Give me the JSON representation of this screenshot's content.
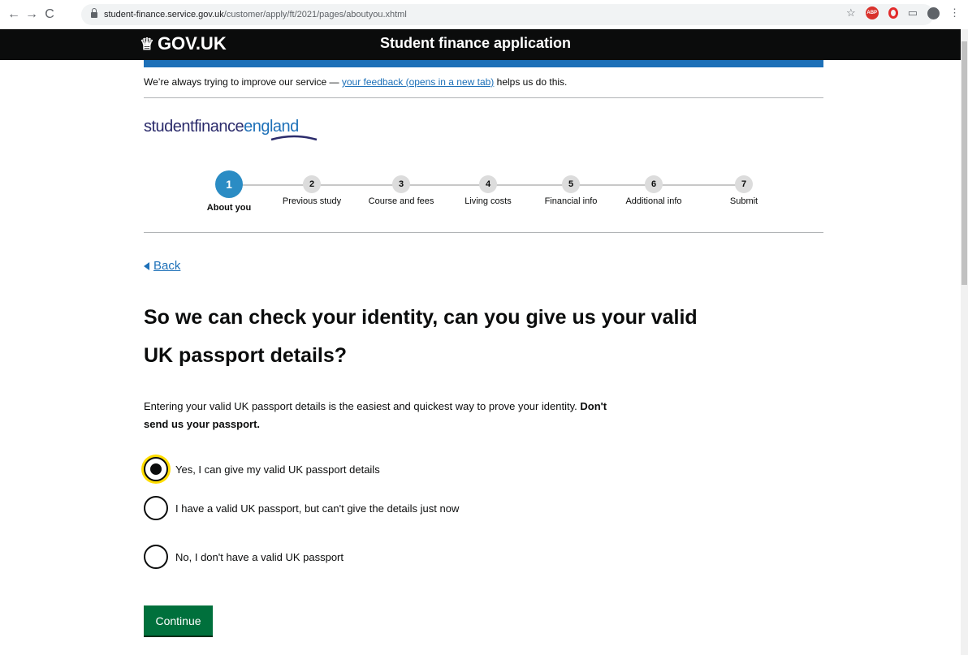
{
  "browser": {
    "url_host": "student-finance.service.gov.uk",
    "url_path": "/customer/apply/ft/2021/pages/aboutyou.xhtml",
    "abp_label": "ABP"
  },
  "header": {
    "logo_text": "GOV.UK",
    "service_name": "Student finance application"
  },
  "feedback": {
    "prefix": "We’re always trying to improve our service — ",
    "link": "your feedback (opens in a new tab)",
    "suffix": " helps us do this."
  },
  "brand": {
    "student_finance": "studentfinance",
    "england": "england"
  },
  "steps": [
    {
      "num": "1",
      "label": "About you",
      "active": true
    },
    {
      "num": "2",
      "label": "Previous study"
    },
    {
      "num": "3",
      "label": "Course and fees"
    },
    {
      "num": "4",
      "label": "Living costs"
    },
    {
      "num": "5",
      "label": "Financial info"
    },
    {
      "num": "6",
      "label": "Additional info"
    },
    {
      "num": "7",
      "label": "Submit"
    }
  ],
  "back_link": "Back",
  "question": {
    "heading": "So we can check your identity, can you give us your valid UK passport details?",
    "hint_plain": "Entering your valid UK passport details is the easiest and quickest way to prove your identity. ",
    "hint_bold": "Don't send us your passport."
  },
  "options": [
    {
      "label": "Yes, I can give my valid UK passport details",
      "checked": true
    },
    {
      "label": "I have a valid UK passport, but can't give the details just now",
      "checked": false
    },
    {
      "label": "No, I don't have a valid UK passport",
      "checked": false
    }
  ],
  "continue_label": "Continue",
  "colors": {
    "govuk_black": "#0b0c0c",
    "govuk_blue": "#1d70b8",
    "step_active": "#2b8cc4",
    "button_green": "#00703c",
    "focus_yellow": "#ffdd00"
  }
}
